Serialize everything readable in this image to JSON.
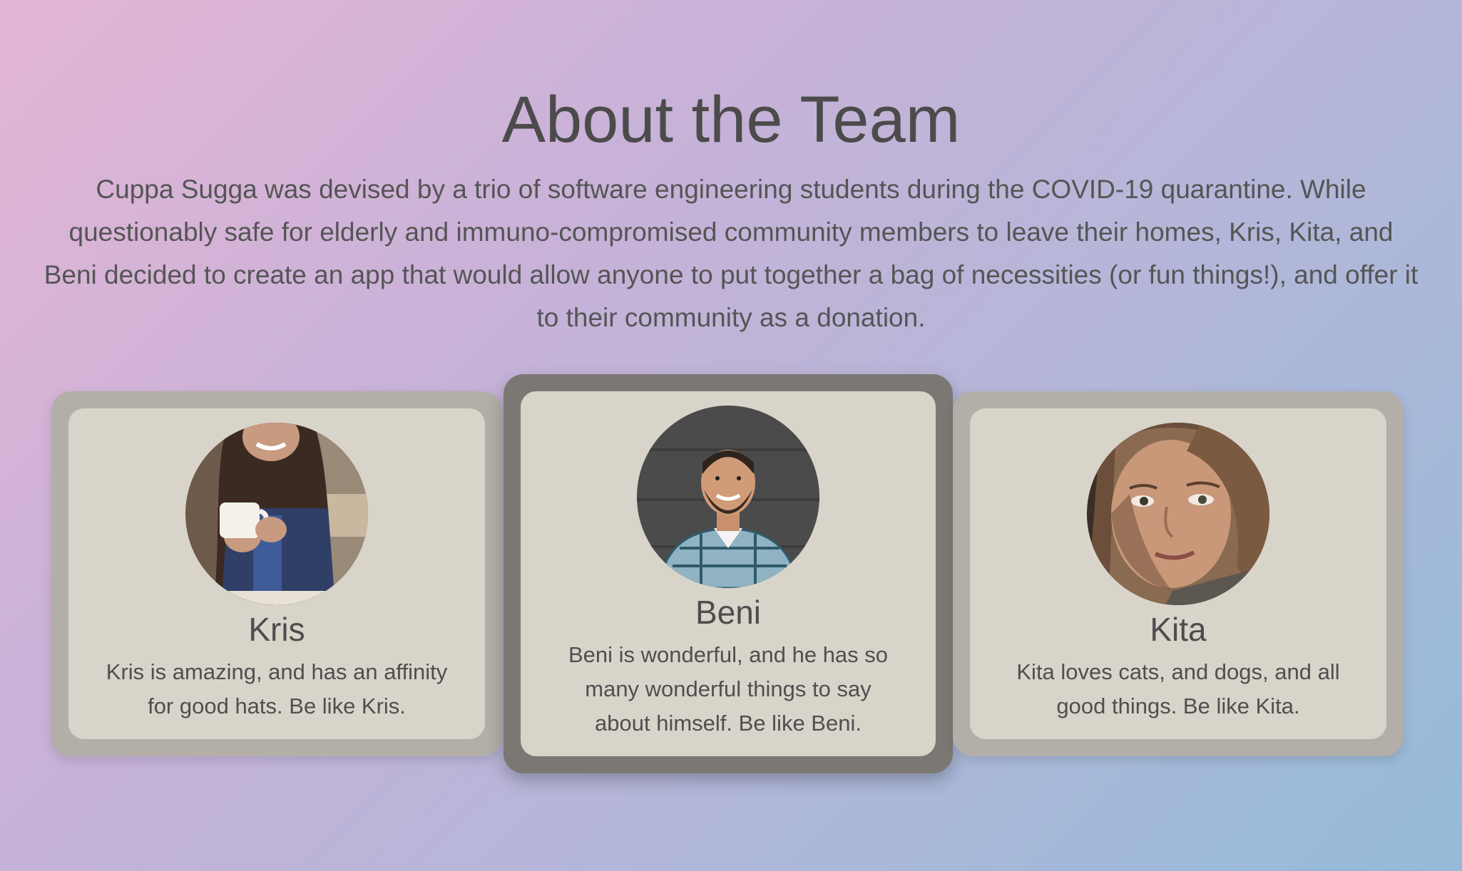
{
  "page": {
    "title": "About the Team",
    "intro": "Cuppa Sugga was devised by a trio of software engineering students during the COVID-19 quarantine. While questionably safe for elderly and immuno-compromised community members to leave their homes, Kris, Kita, and Beni decided to create an app that would allow anyone to put together a bag of necessities (or fun things!), and offer it to their community as a donation."
  },
  "team": [
    {
      "name": "Kris",
      "bio": "Kris is amazing, and has an affinity for good hats. Be like Kris.",
      "avatar_icon": "person-with-coffee-cup-photo",
      "highlighted": false
    },
    {
      "name": "Beni",
      "bio": "Beni is wonderful, and he has so many wonderful things to say about himself. Be like Beni.",
      "avatar_icon": "smiling-man-plaid-shirt-photo",
      "highlighted": true
    },
    {
      "name": "Kita",
      "bio": "Kita loves cats, and dogs, and all good things. Be like Kita.",
      "avatar_icon": "woman-portrait-photo",
      "highlighted": false
    }
  ],
  "colors": {
    "card_frame": "#b3afa8",
    "card_frame_active": "#7b7873",
    "card_body": "#d9d4ca",
    "text": "#4b4b4b"
  }
}
